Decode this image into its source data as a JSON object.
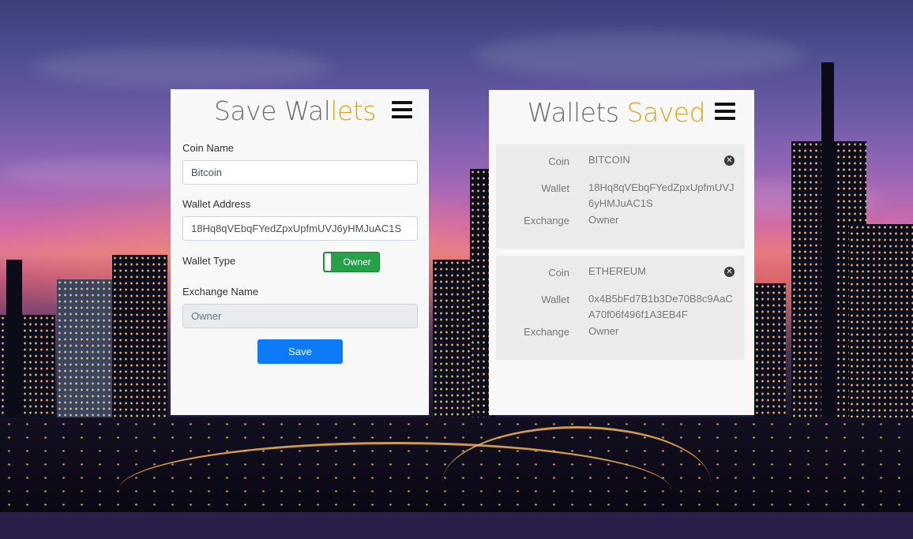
{
  "save_panel": {
    "title_part1": "Save Wal",
    "title_part2": "lets",
    "coin_name_label": "Coin Name",
    "coin_name_value": "Bitcoin",
    "wallet_address_label": "Wallet Address",
    "wallet_address_value": "18Hq8qVEbqFYedZpxUpfmUVJ6yHMJuAC1S",
    "wallet_type_label": "Wallet Type",
    "wallet_type_toggle": "Owner",
    "exchange_name_label": "Exchange Name",
    "exchange_name_value": "Owner",
    "save_button": "Save"
  },
  "saved_panel": {
    "title_part1": "Wallets ",
    "title_part2": "Saved",
    "field_labels": {
      "coin": "Coin",
      "wallet": "Wallet",
      "exchange": "Exchange"
    },
    "wallets": [
      {
        "coin": "BITCOIN",
        "wallet": "18Hq8qVEbqFYedZpxUpfmUVJ6yHMJuAC1S",
        "exchange": "Owner"
      },
      {
        "coin": "ETHEREUM",
        "wallet": "0x4B5bFd7B1b3De70B8c9AaCA70f06f496f1A3EB4F",
        "exchange": "Owner"
      }
    ]
  },
  "colors": {
    "title_gray": "#6e6e6e",
    "title_gold": "#d9a520",
    "save_button": "#0d7bf7",
    "toggle_on": "#28a04a"
  },
  "icons": {
    "menu": "hamburger-menu-icon",
    "remove": "close-circle-icon"
  }
}
